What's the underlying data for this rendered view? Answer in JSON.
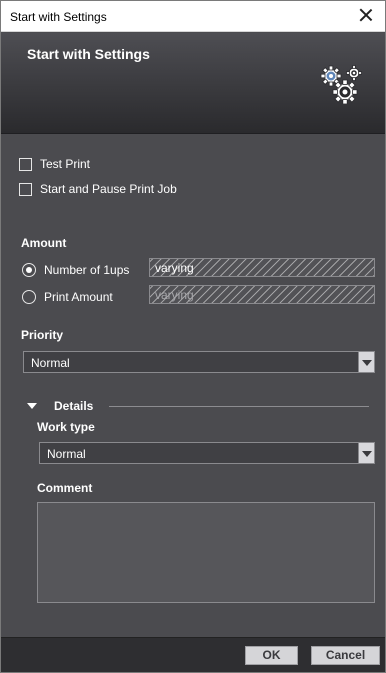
{
  "window": {
    "title": "Start with Settings"
  },
  "header": {
    "title": "Start with Settings",
    "icon": "gears-icon"
  },
  "options": {
    "test_print": {
      "label": "Test Print",
      "checked": false
    },
    "start_pause": {
      "label": "Start and Pause Print Job",
      "checked": false
    }
  },
  "amount": {
    "label": "Amount",
    "number_of_1ups": {
      "label": "Number of 1ups",
      "selected": true,
      "value": "varying"
    },
    "print_amount": {
      "label": "Print Amount",
      "selected": false,
      "value": "varying"
    }
  },
  "priority": {
    "label": "Priority",
    "value": "Normal"
  },
  "details": {
    "label": "Details",
    "expanded": true,
    "work_type": {
      "label": "Work type",
      "value": "Normal"
    },
    "comment": {
      "label": "Comment",
      "value": ""
    }
  },
  "footer": {
    "ok_label": "OK",
    "cancel_label": "Cancel"
  }
}
